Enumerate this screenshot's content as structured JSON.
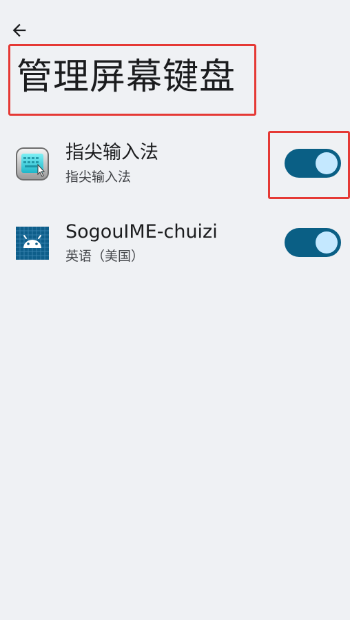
{
  "header": {
    "back_icon": "arrow-left-icon",
    "title": "管理屏幕键盘"
  },
  "keyboards": [
    {
      "title": "指尖输入法",
      "subtitle": "指尖输入法",
      "icon": "keyboard-app-icon",
      "enabled": true
    },
    {
      "title": "SogouIME-chuizi",
      "subtitle": "英语（美国）",
      "icon": "android-icon",
      "enabled": true
    }
  ],
  "colors": {
    "background": "#eff1f4",
    "toggle_track_on": "#0a5f85",
    "toggle_knob_on": "#c4e8ff",
    "highlight": "#e53935"
  }
}
